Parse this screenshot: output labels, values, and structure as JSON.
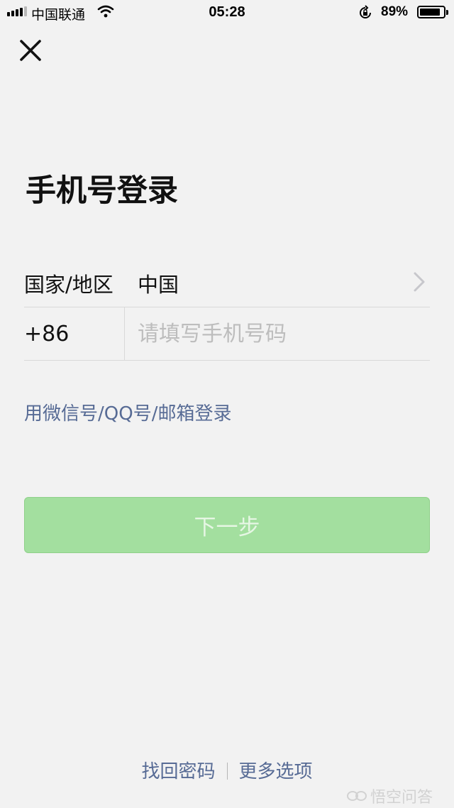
{
  "status_bar": {
    "carrier": "中国联通",
    "time": "05:28",
    "battery_percent": "89%",
    "battery_level": 0.89,
    "signal_bars_active": 4,
    "icons": [
      "signal-icon",
      "wifi-icon",
      "rotation-lock-icon",
      "battery-icon"
    ]
  },
  "header": {
    "close_icon": "close-icon"
  },
  "title": "手机号登录",
  "country_row": {
    "label": "国家/地区",
    "value": "中国",
    "icon": "chevron-right-icon"
  },
  "phone_row": {
    "country_code": "+86",
    "placeholder": "请填写手机号码",
    "value": ""
  },
  "alt_login": "用微信号/QQ号/邮箱登录",
  "next_button": {
    "label": "下一步",
    "enabled": false
  },
  "footer": {
    "retrieve_password": "找回密码",
    "more_options": "更多选项"
  },
  "watermark": "悟空问答",
  "colors": {
    "background": "#f2f2f2",
    "link": "#576b95",
    "button_disabled": "#a3df9f",
    "divider": "#d9d9d9"
  }
}
